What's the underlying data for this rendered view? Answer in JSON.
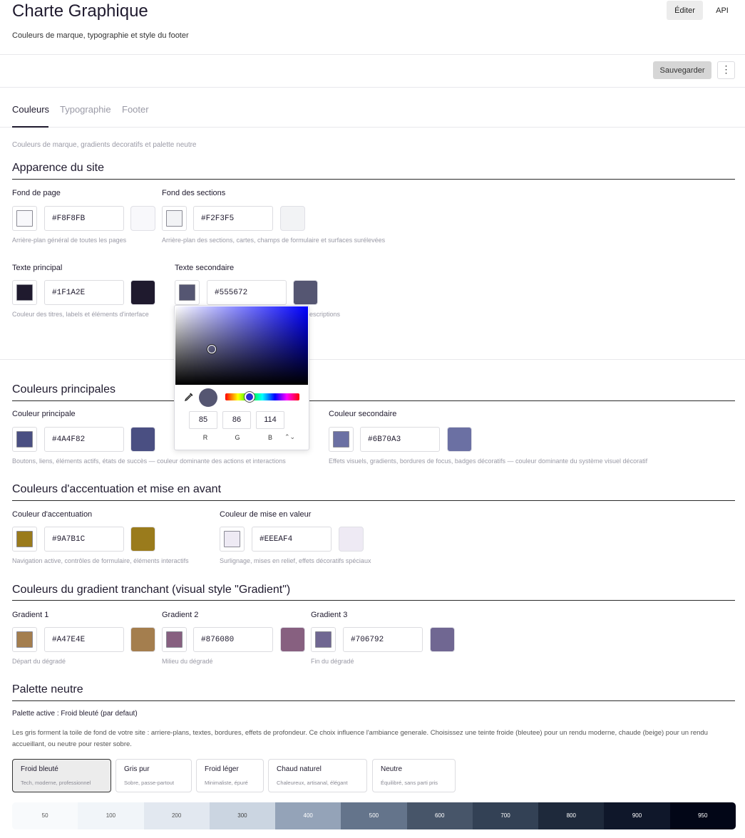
{
  "header": {
    "title": "Charte Graphique",
    "subtitle": "Couleurs de marque, typographie et style du footer",
    "edit_label": "Éditer",
    "api_label": "API"
  },
  "toolbar": {
    "save_label": "Sauvegarder",
    "more_icon": "⋮"
  },
  "tabs": [
    {
      "label": "Couleurs",
      "active": true
    },
    {
      "label": "Typographie",
      "active": false
    },
    {
      "label": "Footer",
      "active": false
    }
  ],
  "section_description": "Couleurs de marque, gradients decoratifs et palette neutre",
  "site": {
    "title": "Apparence du site",
    "fields": [
      {
        "label": "Fond de page",
        "hex": "#F8F8FB",
        "hint": "Arrière-plan général de toutes les pages"
      },
      {
        "label": "Fond des sections",
        "hex": "#F2F3F5",
        "hint": "Arrière-plan des sections, cartes, champs de formulaire et surfaces surélevées"
      },
      {
        "label": "Texte principal",
        "hex": "#1F1A2E",
        "hint": "Couleur des titres, labels et éléments d'interface"
      },
      {
        "label": "Texte secondaire",
        "hex": "#555672",
        "hint": "escriptions"
      }
    ]
  },
  "main": {
    "title": "Couleurs principales",
    "fields": [
      {
        "label": "Couleur principale",
        "hex": "#4A4F82",
        "hint": "Boutons, liens, éléments actifs, états de succès — couleur dominante des actions et interactions"
      },
      {
        "label": "Couleur secondaire",
        "hex": "#6B70A3",
        "hint": "Effets visuels, gradients, bordures de focus, badges décoratifs — couleur dominante du système visuel décoratif"
      }
    ]
  },
  "accent": {
    "title": "Couleurs d'accentuation et mise en avant",
    "fields": [
      {
        "label": "Couleur d'accentuation",
        "hex": "#9A7B1C",
        "hint": "Navigation active, contrôles de formulaire, éléments interactifs"
      },
      {
        "label": "Couleur de mise en valeur",
        "hex": "#EEEAF4",
        "hint": "Surlignage, mises en relief, effets décoratifs spéciaux"
      }
    ]
  },
  "gradient": {
    "title": "Couleurs du gradient tranchant (visual style \"Gradient\")",
    "fields": [
      {
        "label": "Gradient 1",
        "hex": "#A47E4E",
        "hint": "Départ du dégradé"
      },
      {
        "label": "Gradient 2",
        "hex": "#876080",
        "hint": "Milieu du dégradé"
      },
      {
        "label": "Gradient 3",
        "hex": "#706792",
        "hint": "Fin du dégradé"
      }
    ]
  },
  "neutral": {
    "title": "Palette neutre",
    "active_label": "Palette active : Froid bleuté (par defaut)",
    "description": "Les gris forment la toile de fond de votre site : arriere-plans, textes, bordures, effets de profondeur. Ce choix influence l'ambiance generale. Choisissez une teinte froide (bleutee) pour un rendu moderne, chaude (beige) pour un rendu accueillant, ou neutre pour rester sobre.",
    "options": [
      {
        "name": "Froid bleuté",
        "desc": "Tech, moderne, professionnel",
        "active": true
      },
      {
        "name": "Gris pur",
        "desc": "Sobre, passe-partout",
        "active": false
      },
      {
        "name": "Froid léger",
        "desc": "Minimaliste, épuré",
        "active": false
      },
      {
        "name": "Chaud naturel",
        "desc": "Chaleureux, artisanal, élégant",
        "active": false
      },
      {
        "name": "Neutre",
        "desc": "Équilibré, sans parti pris",
        "active": false
      }
    ],
    "scale": [
      {
        "step": "50",
        "color": "#f8fafc",
        "text": "#555"
      },
      {
        "step": "100",
        "color": "#f1f5f9",
        "text": "#555"
      },
      {
        "step": "200",
        "color": "#e2e8f0",
        "text": "#555"
      },
      {
        "step": "300",
        "color": "#cbd5e1",
        "text": "#444"
      },
      {
        "step": "400",
        "color": "#94a3b8",
        "text": "#ffffff"
      },
      {
        "step": "500",
        "color": "#64748b",
        "text": "#ffffff"
      },
      {
        "step": "600",
        "color": "#475569",
        "text": "#ffffff"
      },
      {
        "step": "700",
        "color": "#334155",
        "text": "#ffffff"
      },
      {
        "step": "800",
        "color": "#1e293b",
        "text": "#ffffff"
      },
      {
        "step": "900",
        "color": "#0f172a",
        "text": "#ffffff"
      },
      {
        "step": "950",
        "color": "#020617",
        "text": "#ffffff"
      }
    ]
  },
  "color_picker": {
    "color": "#555672",
    "hue_color": "#0000ff",
    "r": "85",
    "g": "86",
    "b": "114",
    "r_label": "R",
    "g_label": "G",
    "b_label": "B",
    "mode_icon": "⌃⌄"
  }
}
